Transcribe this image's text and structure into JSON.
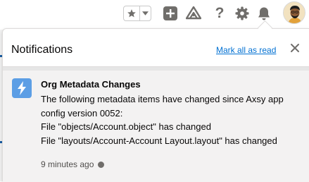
{
  "header": {
    "icons": [
      "star-icon",
      "chevron-down-icon",
      "add-icon",
      "trailhead-icon",
      "help-icon",
      "gear-icon",
      "bell-icon",
      "avatar"
    ],
    "help_label": "?"
  },
  "notifications": {
    "title": "Notifications",
    "mark_all_read": "Mark all as read",
    "items": [
      {
        "icon": "lightning-bolt-icon",
        "title": "Org Metadata Changes",
        "body_lines": [
          "The following metadata items have changed since Axsy app",
          "config version 0052:",
          "File \"objects/Account.object\" has changed",
          "File \"layouts/Account-Account Layout.layout\" has changed"
        ],
        "time": "9 minutes ago",
        "unread": true
      }
    ]
  },
  "colors": {
    "link": "#0070d2",
    "icon_blue": "#5c9ee5",
    "header_icon_gray": "#706e6b",
    "notif_bg": "#f3f2f2"
  }
}
